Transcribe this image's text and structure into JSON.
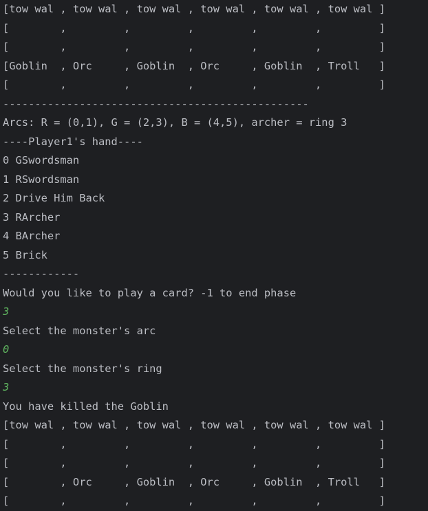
{
  "console": {
    "lines": [
      {
        "text": "[tow wal , tow wal , tow wal , tow wal , tow wal , tow wal ]",
        "type": "output"
      },
      {
        "text": "[        ,         ,         ,         ,         ,         ]",
        "type": "output"
      },
      {
        "text": "[        ,         ,         ,         ,         ,         ]",
        "type": "output"
      },
      {
        "text": "[Goblin  , Orc     , Goblin  , Orc     , Goblin  , Troll   ]",
        "type": "output"
      },
      {
        "text": "[        ,         ,         ,         ,         ,         ]",
        "type": "output"
      },
      {
        "text": "------------------------------------------------",
        "type": "output"
      },
      {
        "text": "Arcs: R = (0,1), G = (2,3), B = (4,5), archer = ring 3",
        "type": "output"
      },
      {
        "text": "----Player1's hand----",
        "type": "output"
      },
      {
        "text": "0 GSwordsman",
        "type": "output"
      },
      {
        "text": "1 RSwordsman",
        "type": "output"
      },
      {
        "text": "2 Drive Him Back",
        "type": "output"
      },
      {
        "text": "3 RArcher",
        "type": "output"
      },
      {
        "text": "4 BArcher",
        "type": "output"
      },
      {
        "text": "5 Brick",
        "type": "output"
      },
      {
        "text": "------------",
        "type": "output"
      },
      {
        "text": "Would you like to play a card? -1 to end phase",
        "type": "output"
      },
      {
        "text": "3",
        "type": "input"
      },
      {
        "text": "Select the monster's arc",
        "type": "output"
      },
      {
        "text": "0",
        "type": "input"
      },
      {
        "text": "Select the monster's ring",
        "type": "output"
      },
      {
        "text": "3",
        "type": "input"
      },
      {
        "text": "You have killed the Goblin",
        "type": "output"
      },
      {
        "text": "[tow wal , tow wal , tow wal , tow wal , tow wal , tow wal ]",
        "type": "output"
      },
      {
        "text": "[        ,         ,         ,         ,         ,         ]",
        "type": "output"
      },
      {
        "text": "[        ,         ,         ,         ,         ,         ]",
        "type": "output"
      },
      {
        "text": "[        , Orc     , Goblin  , Orc     , Goblin  , Troll   ]",
        "type": "output"
      },
      {
        "text": "[        ,         ,         ,         ,         ,         ]",
        "type": "output"
      }
    ]
  },
  "colors": {
    "background": "#1e1f22",
    "output_text": "#bcbec4",
    "input_text": "#5fb35f"
  }
}
